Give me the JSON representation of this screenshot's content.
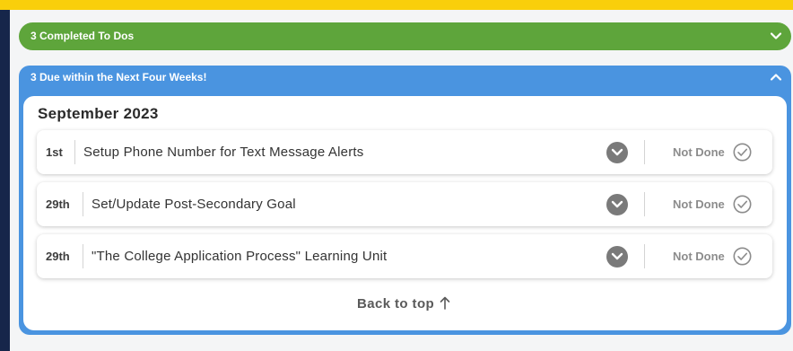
{
  "colors": {
    "accent_yellow": "#f9cf0b",
    "navy": "#16264a",
    "completed_green": "#5ea53b",
    "due_blue": "#4a94e0",
    "status_gray": "#8c8c8c"
  },
  "completed_panel": {
    "title": "3 Completed To Dos",
    "toggle_icon": "chevron-down-icon"
  },
  "due_panel": {
    "title": "3 Due within the Next Four Weeks!",
    "toggle_icon": "chevron-up-icon",
    "month": "September 2023",
    "items": [
      {
        "date": "1st",
        "label": "Setup Phone Number for Text Message Alerts",
        "status": "Not Done"
      },
      {
        "date": "29th",
        "label": "Set/Update Post-Secondary Goal",
        "status": "Not Done"
      },
      {
        "date": "29th",
        "label": "\"The College Application Process\" Learning Unit",
        "status": "Not Done"
      }
    ],
    "back_to_top": "Back to top"
  }
}
